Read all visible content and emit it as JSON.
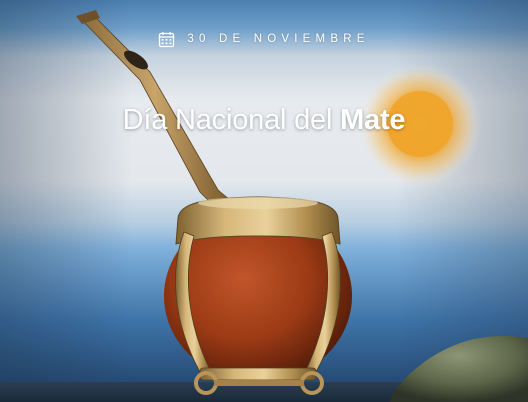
{
  "date_label": "30 DE NOVIEMBRE",
  "title": {
    "regular": "Día Nacional del",
    "bold": "Mate"
  },
  "icons": {
    "date_icon": "calendar-icon"
  },
  "colors": {
    "flag_sky_blue": "#7fb2da",
    "flag_white": "#e9edf2",
    "sun": "#f2a524",
    "gourd": "#9a3b16",
    "brass": "#c9a45f",
    "text": "#ffffff"
  }
}
